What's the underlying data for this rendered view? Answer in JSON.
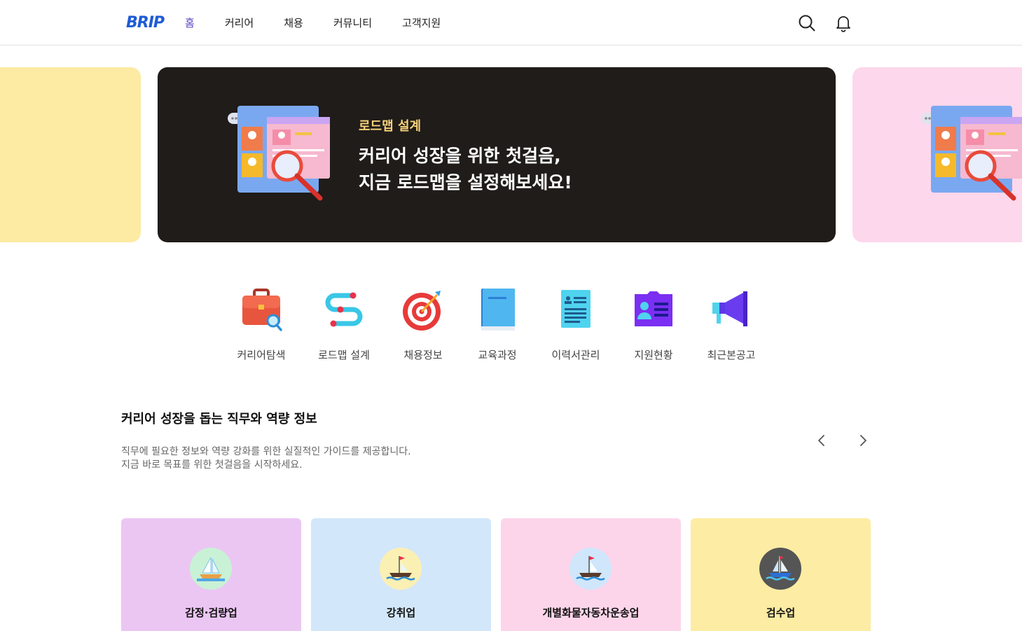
{
  "header": {
    "logo_text": "BRIP",
    "nav": [
      {
        "label": "홈",
        "active": true
      },
      {
        "label": "커리어",
        "active": false
      },
      {
        "label": "채용",
        "active": false
      },
      {
        "label": "커뮤니티",
        "active": false
      },
      {
        "label": "고객지원",
        "active": false
      }
    ],
    "icons": [
      "search-icon",
      "bell-icon"
    ]
  },
  "banner": {
    "kicker": "로드맵 설계",
    "title_line1": "커리어 성장을 위한 첫걸음,",
    "title_line2": "지금 로드맵을 설정해보세요!",
    "colors": {
      "main": "#1f1c19",
      "left": "#fdeaa3",
      "right": "#fdd7ec",
      "kicker": "#f7d27a"
    }
  },
  "quick_menu": [
    {
      "label": "커리어탐색",
      "icon": "briefcase-search-icon"
    },
    {
      "label": "로드맵 설계",
      "icon": "roadmap-path-icon"
    },
    {
      "label": "채용정보",
      "icon": "target-dart-icon"
    },
    {
      "label": "교육과정",
      "icon": "book-icon"
    },
    {
      "label": "이력서관리",
      "icon": "resume-document-icon"
    },
    {
      "label": "지원현황",
      "icon": "id-card-icon"
    },
    {
      "label": "최근본공고",
      "icon": "megaphone-icon"
    }
  ],
  "section": {
    "title": "커리어 성장을 돕는 직무와 역량 정보",
    "desc_line1": "직무에 필요한 정보와 역량 강화를 위한 실질적인 가이드를 제공합니다.",
    "desc_line2": "지금 바로 목표를 위한 첫걸음을 시작하세요."
  },
  "cards": [
    {
      "label": "감정·검량업",
      "bg": "#ebc6f3",
      "icon_bg": "#c9f1d6",
      "icon": "sailboat-icon"
    },
    {
      "label": "강취업",
      "bg": "#d3e7fb",
      "icon_bg": "#fbf0b3",
      "icon": "ship-icon"
    },
    {
      "label": "개별화물자동차운송업",
      "bg": "#fdd5ea",
      "icon_bg": "#cfe6fb",
      "icon": "ship-icon"
    },
    {
      "label": "검수업",
      "bg": "#fdeca3",
      "icon_bg": "#555555",
      "icon": "sailboat-icon"
    }
  ]
}
